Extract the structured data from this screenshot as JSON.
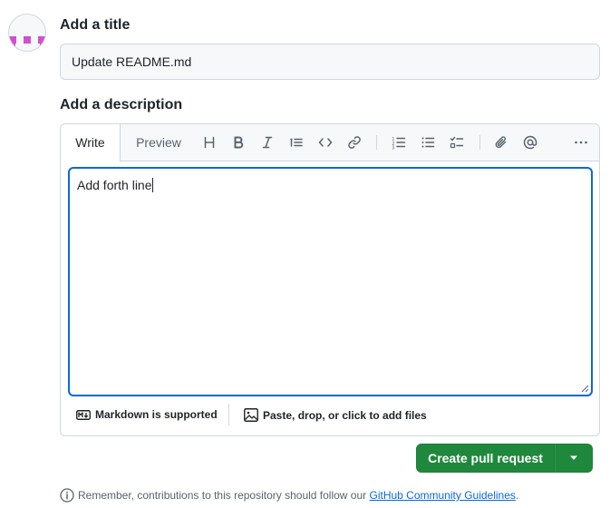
{
  "avatar": {
    "icon": "identicon"
  },
  "title_section": {
    "label": "Add a title",
    "value": "Update README.md"
  },
  "description_section": {
    "label": "Add a description"
  },
  "editor": {
    "tabs": [
      {
        "label": "Write",
        "active": true
      },
      {
        "label": "Preview",
        "active": false
      }
    ],
    "toolbar": [
      "heading-icon",
      "bold-icon",
      "italic-icon",
      "quote-icon",
      "code-icon",
      "link-icon",
      "numbered-list-icon",
      "unordered-list-icon",
      "task-list-icon",
      "attach-icon",
      "mention-icon",
      "more-icon"
    ],
    "body_text": "Add forth line",
    "footer": {
      "markdown_label": "Markdown is supported",
      "attach_label": "Paste, drop, or click to add files"
    }
  },
  "actions": {
    "create_label": "Create pull request"
  },
  "notice": {
    "prefix": "Remember, contributions to this repository should follow our ",
    "link": "GitHub Community Guidelines",
    "suffix": "."
  },
  "colors": {
    "primary": "#1f883d",
    "accent": "#0969da",
    "avatar": "#d54dcd"
  }
}
